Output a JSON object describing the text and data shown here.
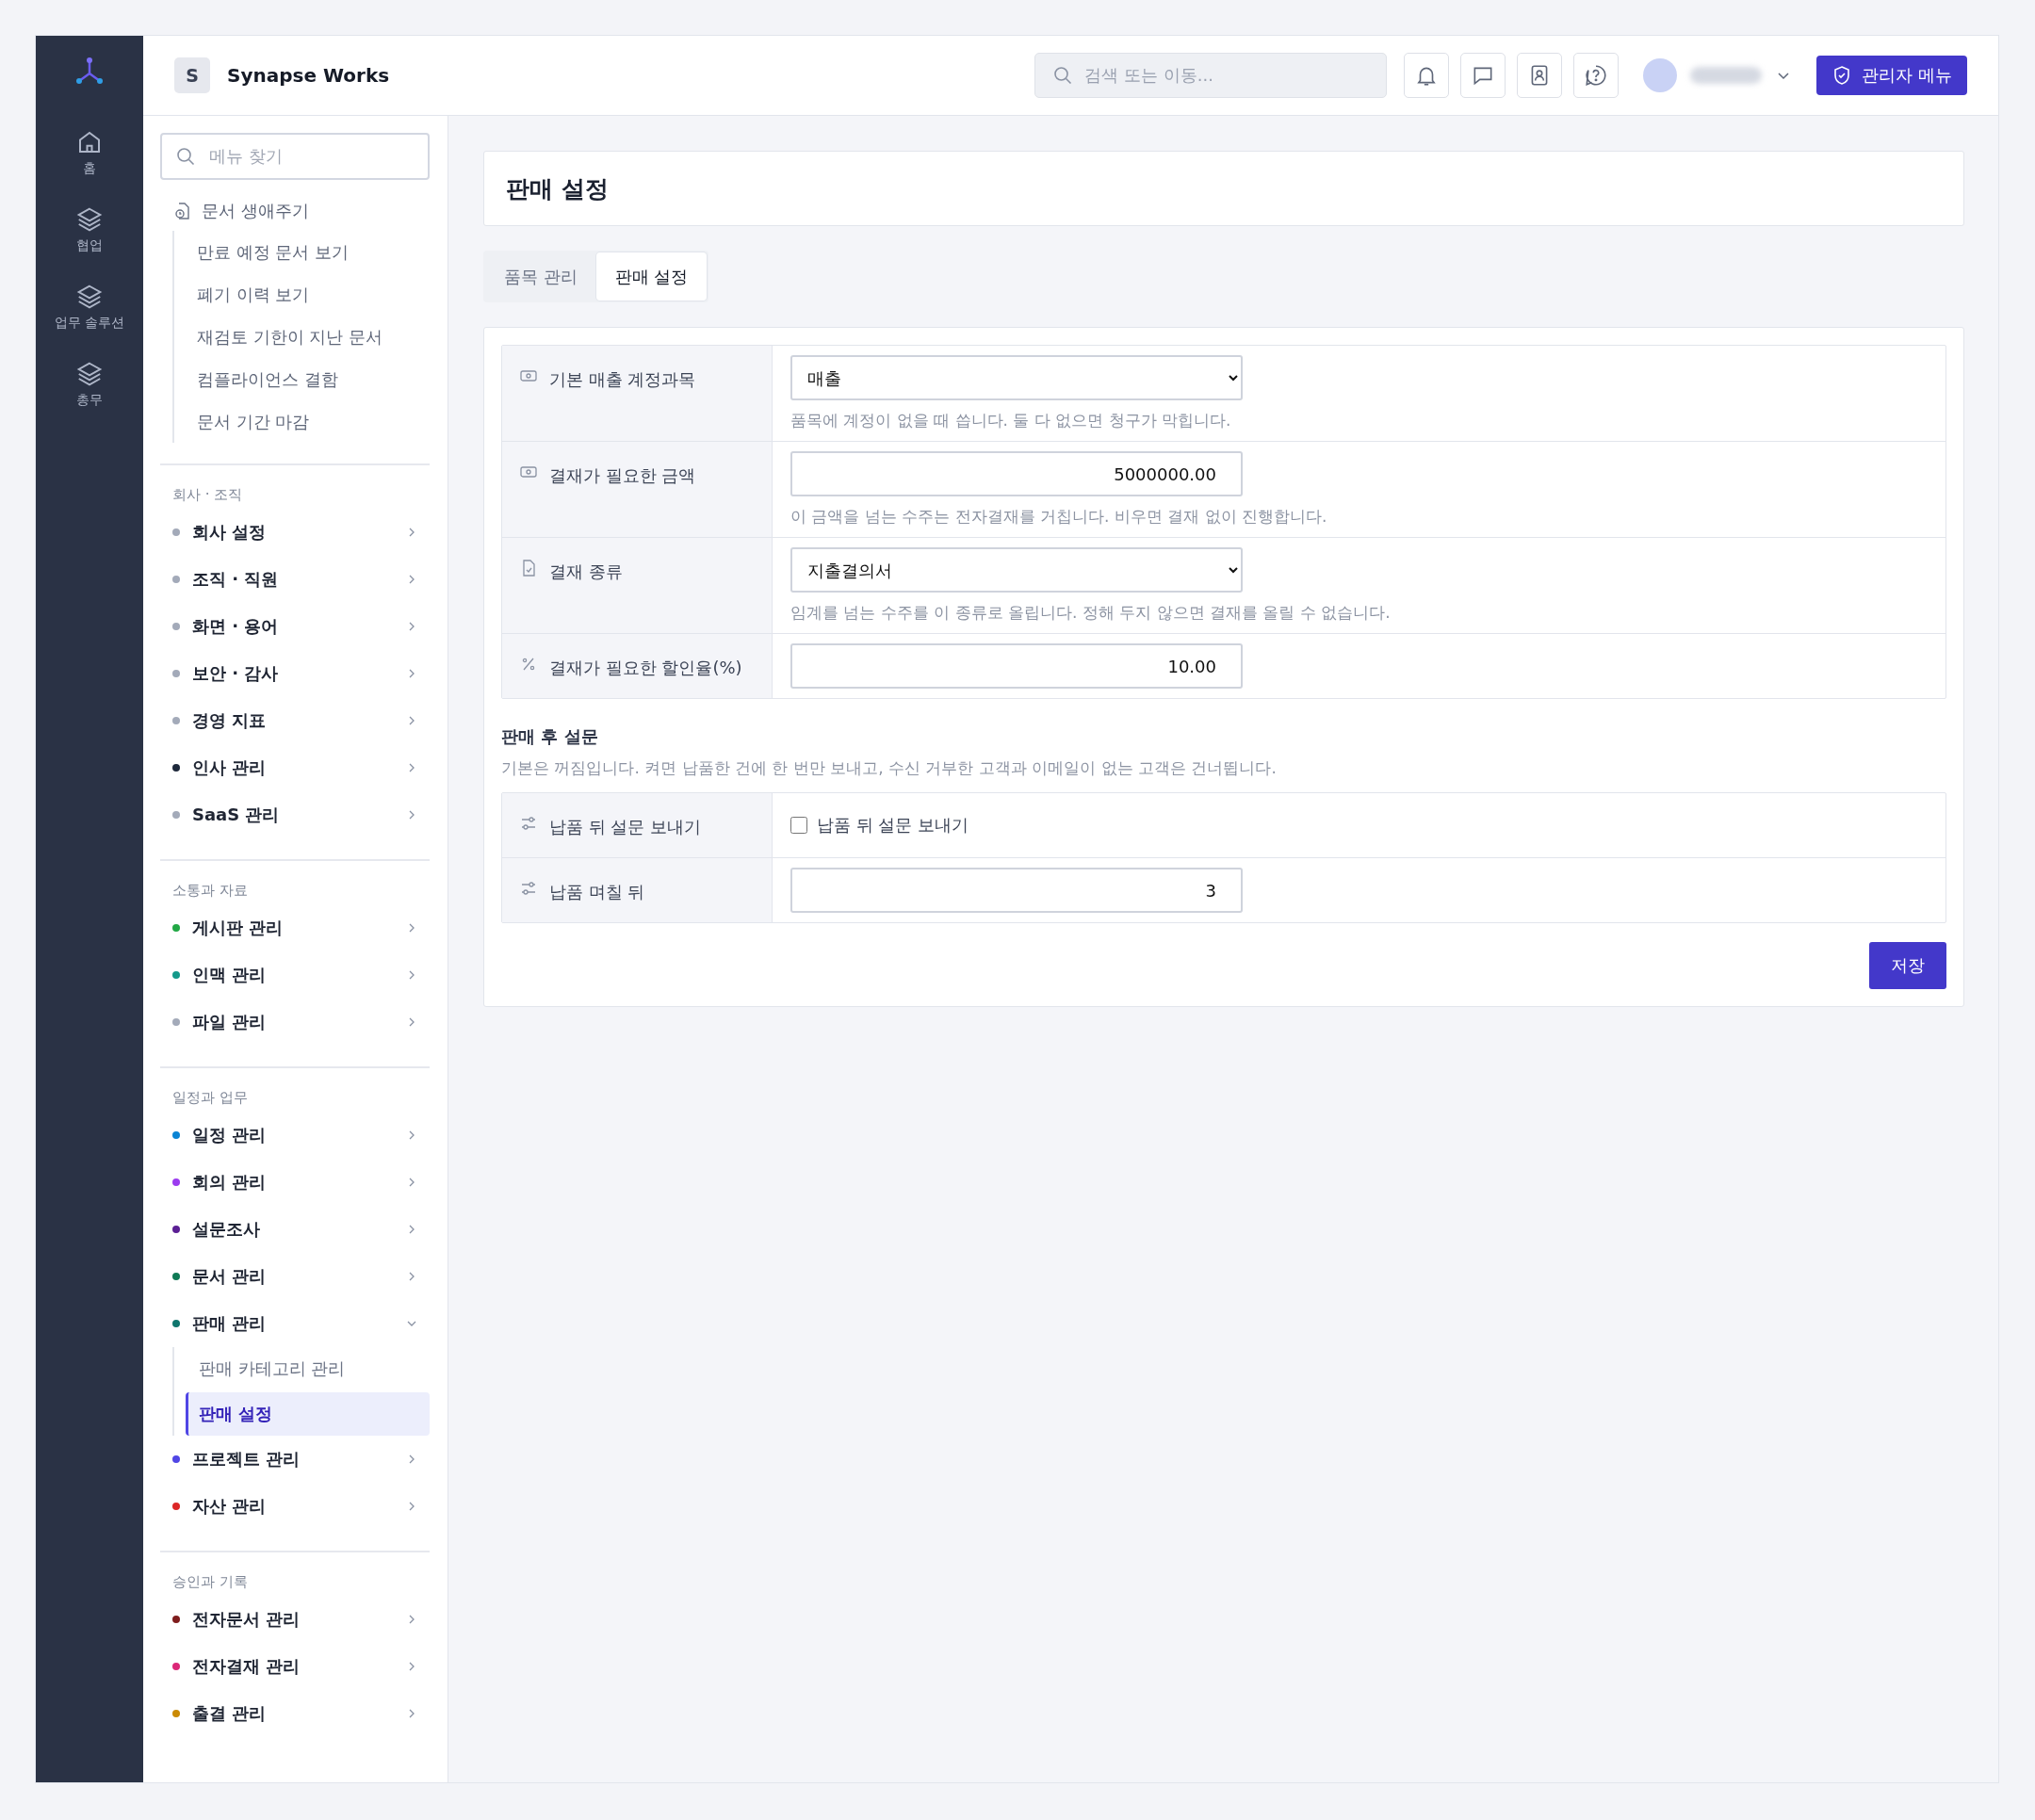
{
  "app": {
    "logo_letter": "S",
    "name": "Synapse Works"
  },
  "topbar": {
    "search_placeholder": "검색 또는 이동...",
    "admin_button": "관리자 메뉴"
  },
  "rail": [
    {
      "kind": "home",
      "label": "홈"
    },
    {
      "kind": "layers",
      "label": "협업"
    },
    {
      "kind": "layers",
      "label": "업무 솔루션"
    },
    {
      "kind": "layers",
      "label": "총무"
    }
  ],
  "sidebar": {
    "search_placeholder": "메뉴 찾기",
    "tree": {
      "label": "문서 생애주기",
      "children": [
        {
          "label": "만료 예정 문서 보기",
          "selected": false
        },
        {
          "label": "폐기 이력 보기",
          "selected": false
        },
        {
          "label": "재검토 기한이 지난 문서",
          "selected": false
        },
        {
          "label": "컴플라이언스 결함",
          "selected": false
        },
        {
          "label": "문서 기간 마감",
          "selected": false
        }
      ]
    },
    "sections": [
      {
        "title": "회사 · 조직",
        "items": [
          {
            "label": "회사 설정",
            "color": "#a3aab9",
            "expanded": false
          },
          {
            "label": "조직 · 직원",
            "color": "#a3aab9",
            "expanded": false
          },
          {
            "label": "화면 · 용어",
            "color": "#a3aab9",
            "expanded": false
          },
          {
            "label": "보안 · 감사",
            "color": "#a3aab9",
            "expanded": false
          },
          {
            "label": "경영 지표",
            "color": "#a3aab9",
            "expanded": false
          },
          {
            "label": "인사 관리",
            "color": "#1e293b",
            "expanded": false
          },
          {
            "label": "SaaS 관리",
            "color": "#a3aab9",
            "expanded": false
          }
        ]
      },
      {
        "title": "소통과 자료",
        "items": [
          {
            "label": "게시판 관리",
            "color": "#22a845",
            "expanded": false
          },
          {
            "label": "인맥 관리",
            "color": "#14998a",
            "expanded": false
          },
          {
            "label": "파일 관리",
            "color": "#a3aab9",
            "expanded": false
          }
        ]
      },
      {
        "title": "일정과 업무",
        "items": [
          {
            "label": "일정 관리",
            "color": "#0b84d4",
            "expanded": false
          },
          {
            "label": "회의 관리",
            "color": "#9b3bef",
            "expanded": false
          },
          {
            "label": "설문조사",
            "color": "#5b1f94",
            "expanded": false
          },
          {
            "label": "문서 관리",
            "color": "#0f7a55",
            "expanded": false
          },
          {
            "label": "판매 관리",
            "color": "#0f766e",
            "expanded": true,
            "children": [
              {
                "label": "판매 카테고리 관리",
                "selected": false
              },
              {
                "label": "판매 설정",
                "selected": true
              }
            ]
          },
          {
            "label": "프로젝트 관리",
            "color": "#5046e5",
            "expanded": false
          },
          {
            "label": "자산 관리",
            "color": "#dc2626",
            "expanded": false
          }
        ]
      },
      {
        "title": "승인과 기록",
        "items": [
          {
            "label": "전자문서 관리",
            "color": "#7f1d1d",
            "expanded": false
          },
          {
            "label": "전자결재 관리",
            "color": "#db2777",
            "expanded": false
          },
          {
            "label": "출결 관리",
            "color": "#ca8a04",
            "expanded": false
          }
        ]
      }
    ]
  },
  "page_title": "판매 설정",
  "tabs": [
    {
      "label": "품목 관리",
      "selected": false
    },
    {
      "label": "판매 설정",
      "selected": true
    }
  ],
  "form_rows": [
    {
      "kind": "select",
      "label": "기본 매출 계정과목",
      "value": "매출",
      "help": "품목에 계정이 없을 때 씁니다. 둘 다 없으면 청구가 막힙니다."
    },
    {
      "kind": "number",
      "label": "결재가 필요한 금액",
      "value": "5000000.00",
      "help": "이 금액을 넘는 수주는 전자결재를 거칩니다. 비우면 결재 없이 진행합니다."
    },
    {
      "kind": "select",
      "label": "결재 종류",
      "value": "지출결의서",
      "help": "임계를 넘는 수주를 이 종류로 올립니다. 정해 두지 않으면 결재를 올릴 수 없습니다."
    },
    {
      "kind": "number",
      "label": "결재가 필요한 할인율(%)",
      "value": "10.00"
    }
  ],
  "survey": {
    "title": "판매 후 설문",
    "description": "기본은 꺼짐입니다. 켜면 납품한 건에 한 번만 보내고, 수신 거부한 고객과 이메일이 없는 고객은 건너뜁니다.",
    "rows": [
      {
        "kind": "checkbox",
        "label": "납품 뒤 설문 보내기",
        "checkbox_label": "납품 뒤 설문 보내기",
        "checked": false
      },
      {
        "kind": "number",
        "label": "납품 며칠 뒤",
        "value": "3"
      }
    ]
  },
  "save_button": "저장"
}
